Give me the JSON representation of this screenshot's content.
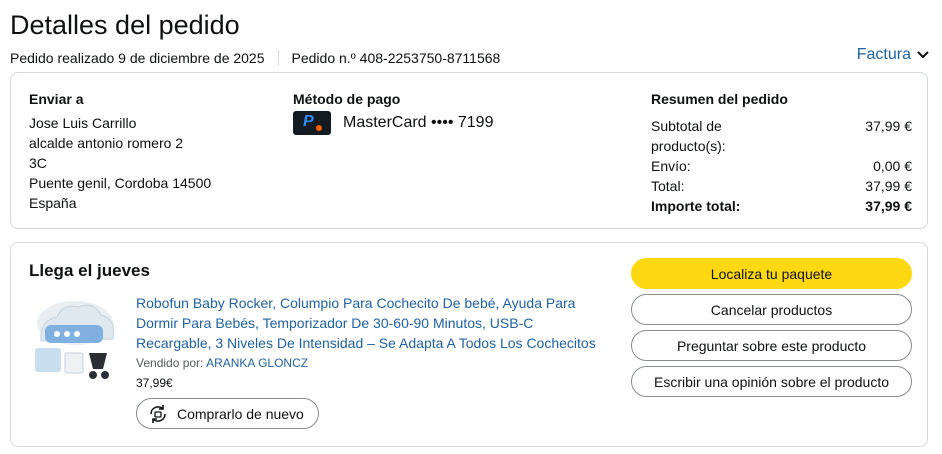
{
  "header": {
    "title": "Detalles del pedido",
    "placed": "Pedido realizado 9 de diciembre de 2025",
    "order_number": "Pedido n.º 408-2253750-8711568",
    "invoice": "Factura"
  },
  "shipping": {
    "heading": "Enviar a",
    "lines": [
      "Jose Luis Carrillo",
      "alcalde antonio romero 2",
      "3C",
      "Puente genil, Cordoba 14500",
      "España"
    ]
  },
  "payment": {
    "heading": "Método de pago",
    "card": "MasterCard •••• 7199",
    "icon": "payment-card-icon"
  },
  "summary": {
    "heading": "Resumen del pedido",
    "rows": [
      {
        "label": "Subtotal de producto(s):",
        "value": "37,99 €"
      },
      {
        "label": "Envío:",
        "value": "0,00 €"
      },
      {
        "label": "Total:",
        "value": "37,99 €"
      },
      {
        "label": "Importe total:",
        "value": "37,99 €"
      }
    ]
  },
  "shipment": {
    "arrival": "Llega el jueves",
    "product_title": "Robofun Baby Rocker, Columpio Para Cochecito De bebé, Ayuda Para Dormir Para Bebés, Temporizador De 30-60-90 Minutos, USB-C Recargable, 3 Niveles De Intensidad – Se Adapta A Todos Los Cochecitos",
    "sold_by_label": "Vendido por:",
    "seller": "ARANKA GLONCZ",
    "price": "37,99€",
    "buy_again": "Comprarlo de nuevo",
    "actions": [
      "Localiza tu paquete",
      "Cancelar productos",
      "Preguntar sobre este producto",
      "Escribir una opinión sobre el producto"
    ]
  },
  "colors": {
    "primary_button": "#ffd814",
    "link": "#2162a1",
    "border": "#d5d9d9"
  }
}
